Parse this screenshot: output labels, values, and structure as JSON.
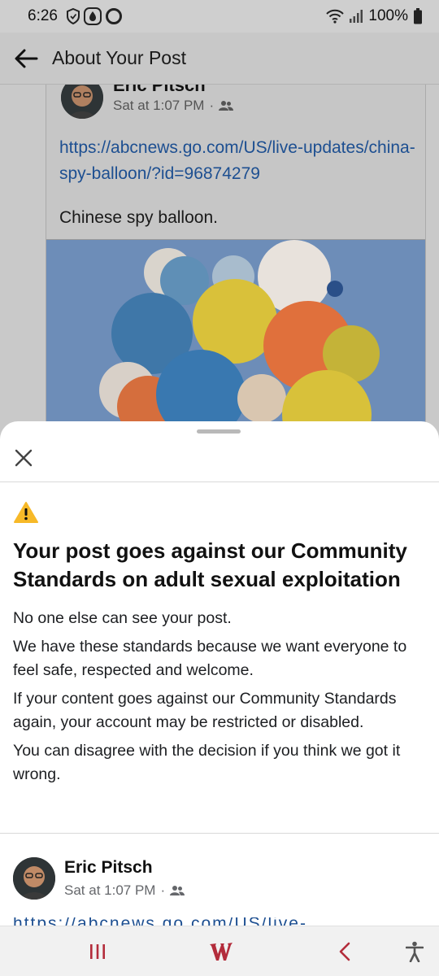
{
  "status_bar": {
    "time": "6:26",
    "battery": "100%",
    "icons": [
      "shield-icon",
      "water-drop-icon",
      "circle-icon",
      "wifi-icon",
      "signal-icon",
      "battery-icon"
    ]
  },
  "header": {
    "title": "About Your Post",
    "back_icon": "arrow-left-icon"
  },
  "background_post": {
    "author": "Eric Pitsch",
    "timestamp": "Sat at 1:07 PM",
    "audience_icon": "friends-icon",
    "link": "https://abcnews.go.com/US/live-updates/china-spy-balloon/?id=96874279",
    "caption": "Chinese spy balloon."
  },
  "sheet": {
    "warning_icon": "warning-icon",
    "headline": "Your post goes against our Community Standards on adult sexual exploitation",
    "paragraphs": [
      "No one else can see your post.",
      "We have these standards because we want everyone to feel safe, respected and welcome.",
      "If your content goes against our Community Standards again, your account may be restricted or disabled.",
      "You can disagree with the decision if you think we got it wrong."
    ],
    "post_author": "Eric Pitsch",
    "post_timestamp": "Sat at 1:07 PM"
  },
  "navbar": {
    "items": [
      "recents-icon",
      "home-icon",
      "back-icon",
      "accessibility-icon"
    ]
  },
  "colors": {
    "link": "#1d4f91",
    "warning": "#f7b928",
    "accent": "#b32c3b"
  }
}
